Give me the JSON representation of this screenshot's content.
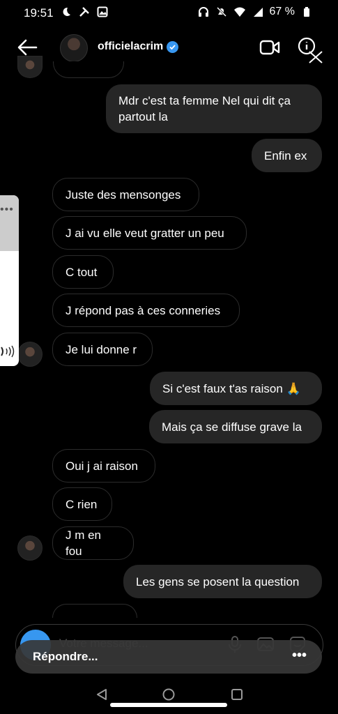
{
  "status_bar": {
    "time": "19:51",
    "battery": "67 %"
  },
  "header": {
    "username": "officielacrim"
  },
  "messages": [
    {
      "text": "Mdr c'est ta femme Nel qui dit ça partout la"
    },
    {
      "text": "Enfin ex"
    },
    {
      "text": "Juste des mensonges"
    },
    {
      "text": "J ai vu elle veut gratter un peu"
    },
    {
      "text": "C tout"
    },
    {
      "text": "J répond pas à ces conneries"
    },
    {
      "text": "Je lui donne r"
    },
    {
      "text": "Si c'est faux t'as raison 🙏"
    },
    {
      "text": "Mais ça se diffuse grave la"
    },
    {
      "text": "Oui j ai raison"
    },
    {
      "text": "C rien"
    },
    {
      "text": "J m en fou"
    },
    {
      "text": "Les gens se posent la question"
    }
  ],
  "composer": {
    "placeholder": "Votre message..."
  },
  "reply_bar": {
    "label": "Répondre..."
  },
  "colors": {
    "verified": "#3797f0",
    "outgoing_bubble": "#262626",
    "accent": "#3797f0"
  }
}
